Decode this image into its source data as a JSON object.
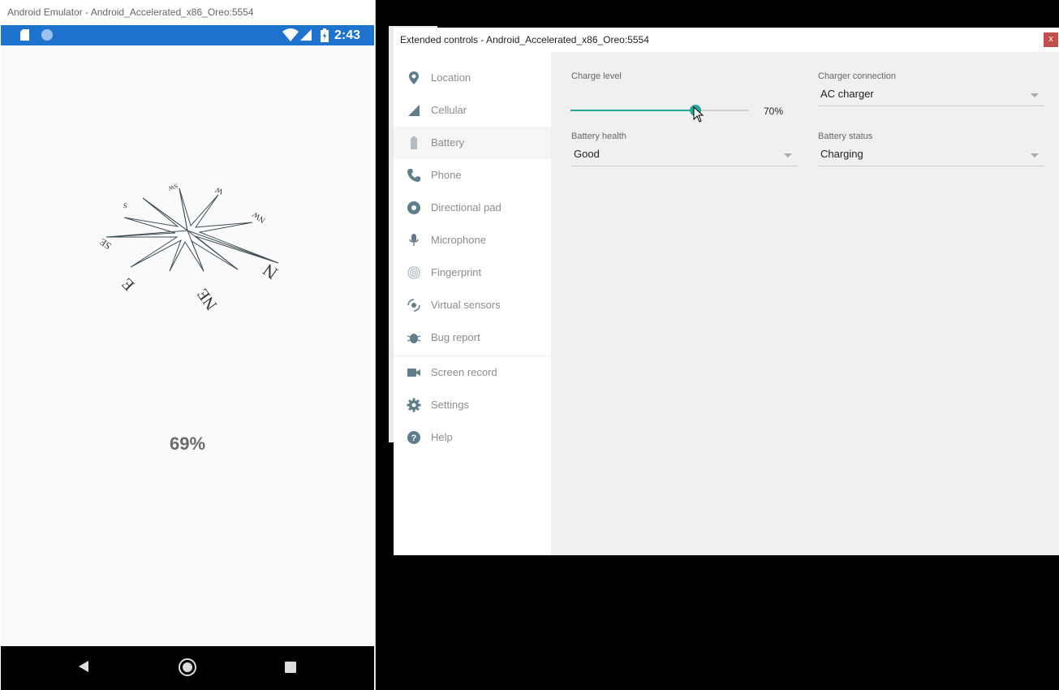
{
  "emulator": {
    "title": "Android Emulator - Android_Accelerated_x86_Oreo:5554",
    "status_bar": {
      "time": "2:43",
      "color": "#1e73cf"
    },
    "compass_labels": [
      "SW",
      "W",
      "NW",
      "N",
      "NE",
      "E",
      "SE",
      "S"
    ],
    "battery_percent_text": "69%"
  },
  "extended_controls": {
    "title": "Extended controls - Android_Accelerated_x86_Oreo:5554",
    "close_label": "x",
    "nav_items": [
      {
        "label": "Location",
        "icon": "location-pin-icon"
      },
      {
        "label": "Cellular",
        "icon": "cellular-signal-icon"
      },
      {
        "label": "Battery",
        "icon": "battery-icon",
        "selected": true
      },
      {
        "label": "Phone",
        "icon": "phone-icon"
      },
      {
        "label": "Directional pad",
        "icon": "dpad-icon"
      },
      {
        "label": "Microphone",
        "icon": "microphone-icon"
      },
      {
        "label": "Fingerprint",
        "icon": "fingerprint-icon"
      },
      {
        "label": "Virtual sensors",
        "icon": "virtual-sensors-icon"
      },
      {
        "label": "Bug report",
        "icon": "bug-icon"
      },
      {
        "label": "Screen record",
        "icon": "video-camera-icon"
      },
      {
        "label": "Settings",
        "icon": "gear-icon"
      },
      {
        "label": "Help",
        "icon": "help-icon"
      }
    ],
    "battery": {
      "charge_level_label": "Charge level",
      "charge_level_value": 70,
      "charge_level_text": "70%",
      "charger_connection_label": "Charger connection",
      "charger_connection_value": "AC charger",
      "battery_health_label": "Battery health",
      "battery_health_value": "Good",
      "battery_status_label": "Battery status",
      "battery_status_value": "Charging"
    },
    "accent_color": "#26a69a"
  }
}
